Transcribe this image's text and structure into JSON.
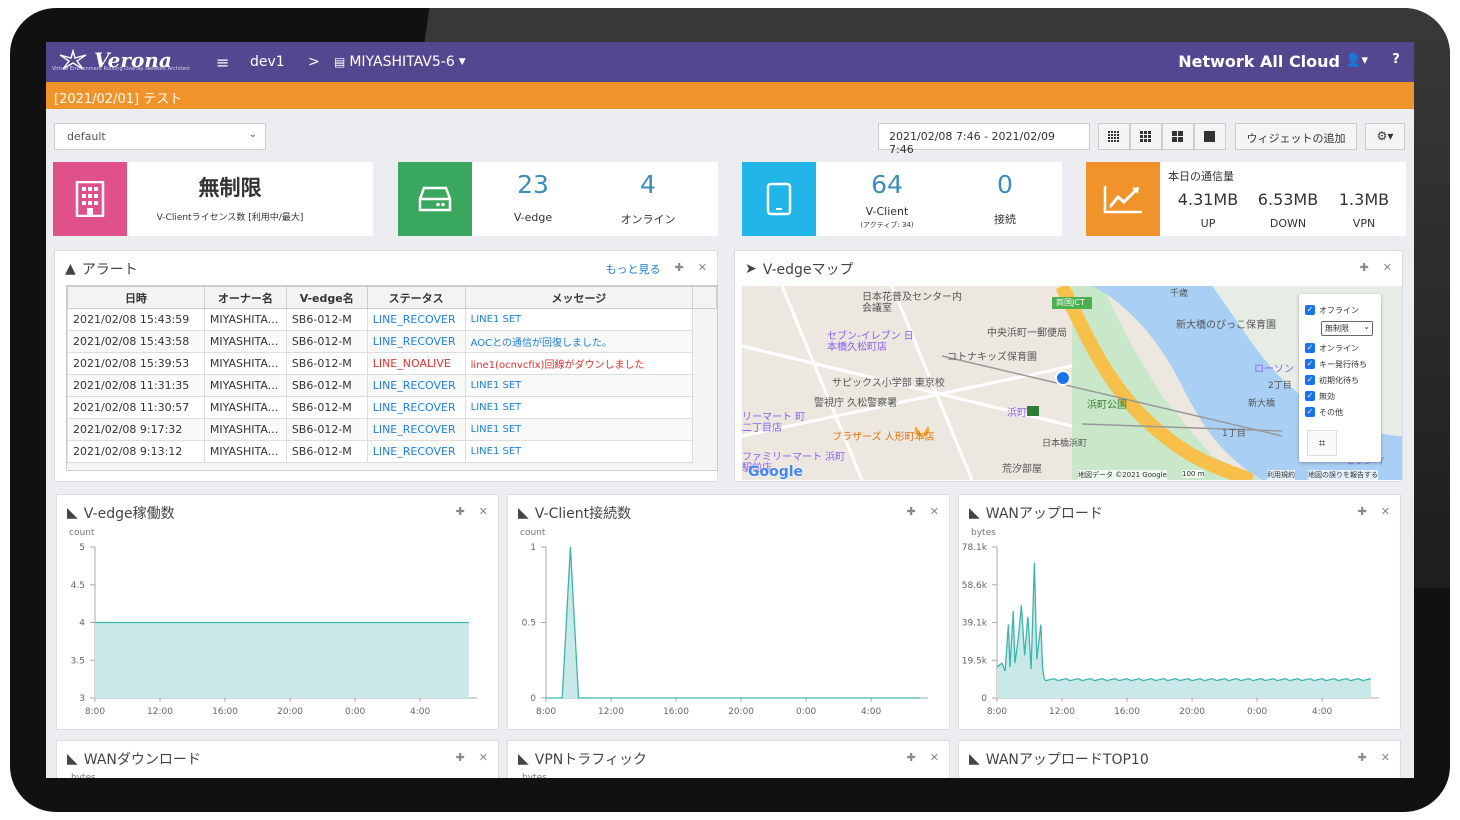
{
  "header": {
    "logo": "Verona",
    "logo_sub": "Virtual Environment Routing Overlay Network Architect",
    "crumb1": "dev1",
    "crumb_sep": ">",
    "crumb2": "MIYASHITAV5-6",
    "brand": "Network All Cloud"
  },
  "notice": "[2021/02/01] テスト",
  "toolbar": {
    "select_value": "default",
    "daterange": "2021/02/08 7:46 - 2021/02/09 7:46",
    "add_widget": "ウィジェットの追加"
  },
  "stats": {
    "license": {
      "value": "無制限",
      "label": "V-Clientライセンス数 [利用中/最大]",
      "color": "#e0508a"
    },
    "vedge": {
      "count": "23",
      "count_label": "V-edge",
      "online": "4",
      "online_label": "オンライン",
      "color": "#3aa75e"
    },
    "vclient": {
      "count": "64",
      "count_label": "V-Client",
      "sub": "(アクティブ: 34)",
      "conn": "0",
      "conn_label": "接続",
      "color": "#22b5e8"
    },
    "traffic": {
      "title": "本日の通信量",
      "up": "4.31MB",
      "up_label": "UP",
      "down": "6.53MB",
      "down_label": "DOWN",
      "vpn": "1.3MB",
      "vpn_label": "VPN",
      "color": "#f0932b"
    }
  },
  "alert": {
    "title": "アラート",
    "more": "もっと見る",
    "headers": [
      "日時",
      "オーナー名",
      "V-edge名",
      "ステータス",
      "メッセージ"
    ],
    "rows": [
      [
        "2021/02/08 15:43:59",
        "MIYASHITA...",
        "SB6-012-M",
        "LINE_RECOVER",
        "LINE1 SET"
      ],
      [
        "2021/02/08 15:43:58",
        "MIYASHITA...",
        "SB6-012-M",
        "LINE_RECOVER",
        "AOCとの通信が回復しました。"
      ],
      [
        "2021/02/08 15:39:53",
        "MIYASHITA...",
        "SB6-012-M",
        "LINE_NOALIVE",
        "line1(ocnvcfix)回線がダウンしました"
      ],
      [
        "2021/02/08 11:31:35",
        "MIYASHITA...",
        "SB6-012-M",
        "LINE_RECOVER",
        "LINE1 SET"
      ],
      [
        "2021/02/08 11:30:57",
        "MIYASHITA...",
        "SB6-012-M",
        "LINE_RECOVER",
        "LINE1 SET"
      ],
      [
        "2021/02/08 9:17:32",
        "MIYASHITA...",
        "SB6-012-M",
        "LINE_RECOVER",
        "LINE1 SET"
      ],
      [
        "2021/02/08 9:13:12",
        "MIYASHITA...",
        "SB6-012-M",
        "LINE_RECOVER",
        "LINE1 SET"
      ]
    ]
  },
  "map": {
    "title": "V-edgeマップ",
    "filters": [
      "オフライン",
      "オンライン",
      "キー発行待ち",
      "初期化待ち",
      "無効",
      "その他"
    ],
    "filter_select": "無制限",
    "labels": [
      "日本花普及センター内会議室",
      "中央浜町一郵便局",
      "セブン-イレブン 日本橋久松町店",
      "コトナキッズ保育園",
      "サピックス小学部 東京校",
      "警視庁 久松警察署",
      "浜町",
      "浜町公園",
      "プラザーズ 人形町本店",
      "日本橋浜町",
      "荒汐部屋",
      "新大橋のぴっこ保育園",
      "ローソン",
      "千歳",
      "両国JCT",
      "新大橋",
      "2丁目",
      "1丁目",
      "リーマート 町二丁目店",
      "ファミリーマート 浜町駅前店",
      "セブン-イ"
    ],
    "copyright": "地図データ ©2021 Google",
    "scale": "100 m",
    "terms": "利用規約",
    "report": "地図の誤りを報告する",
    "google": "Google"
  },
  "charts": [
    {
      "title": "V-edge稼働数",
      "unit": "count",
      "yticks": [
        "5",
        "4.5",
        "4",
        "3.5",
        "3"
      ],
      "xticks": [
        "8:00",
        "12:00",
        "16:00",
        "20:00",
        "0:00",
        "4:00"
      ]
    },
    {
      "title": "V-Client接続数",
      "unit": "count",
      "yticks": [
        "1",
        "0.5",
        "0"
      ],
      "xticks": [
        "8:00",
        "12:00",
        "16:00",
        "20:00",
        "0:00",
        "4:00"
      ]
    },
    {
      "title": "WANアップロード",
      "unit": "bytes",
      "yticks": [
        "78.1k",
        "58.6k",
        "39.1k",
        "19.5k",
        "0"
      ],
      "xticks": [
        "8:00",
        "12:00",
        "16:00",
        "20:00",
        "0:00",
        "4:00"
      ]
    },
    {
      "title": "WANダウンロード",
      "unit": "bytes"
    },
    {
      "title": "VPNトラフィック",
      "unit": "bytes"
    },
    {
      "title": "WANアップロードTOP10"
    }
  ],
  "chart_data": [
    {
      "type": "area",
      "title": "V-edge稼働数",
      "ylabel": "count",
      "ylim": [
        3,
        5
      ],
      "x": [
        "8:00",
        "12:00",
        "16:00",
        "20:00",
        "0:00",
        "4:00"
      ],
      "series": [
        {
          "values": [
            4,
            4,
            4,
            4,
            4,
            4
          ]
        }
      ]
    },
    {
      "type": "area",
      "title": "V-Client接続数",
      "ylabel": "count",
      "ylim": [
        0,
        1
      ],
      "x": [
        "8:00",
        "8:30",
        "9:00",
        "9:30",
        "10:00",
        "12:00",
        "16:00",
        "20:00",
        "0:00",
        "4:00",
        "7:00"
      ],
      "series": [
        {
          "values": [
            0,
            0,
            0,
            1,
            0,
            0,
            0,
            0,
            0,
            0,
            0
          ]
        }
      ]
    },
    {
      "type": "area",
      "title": "WANアップロード",
      "ylabel": "bytes",
      "ylim": [
        0,
        78100
      ],
      "x": [
        "8:00",
        "9:00",
        "10:00",
        "10:30",
        "11:00",
        "12:00",
        "16:00",
        "20:00",
        "0:00",
        "4:00",
        "7:00"
      ],
      "series": [
        {
          "values": [
            16000,
            50000,
            38000,
            70000,
            38000,
            10000,
            9500,
            9500,
            9500,
            9500,
            9500
          ]
        }
      ]
    }
  ]
}
